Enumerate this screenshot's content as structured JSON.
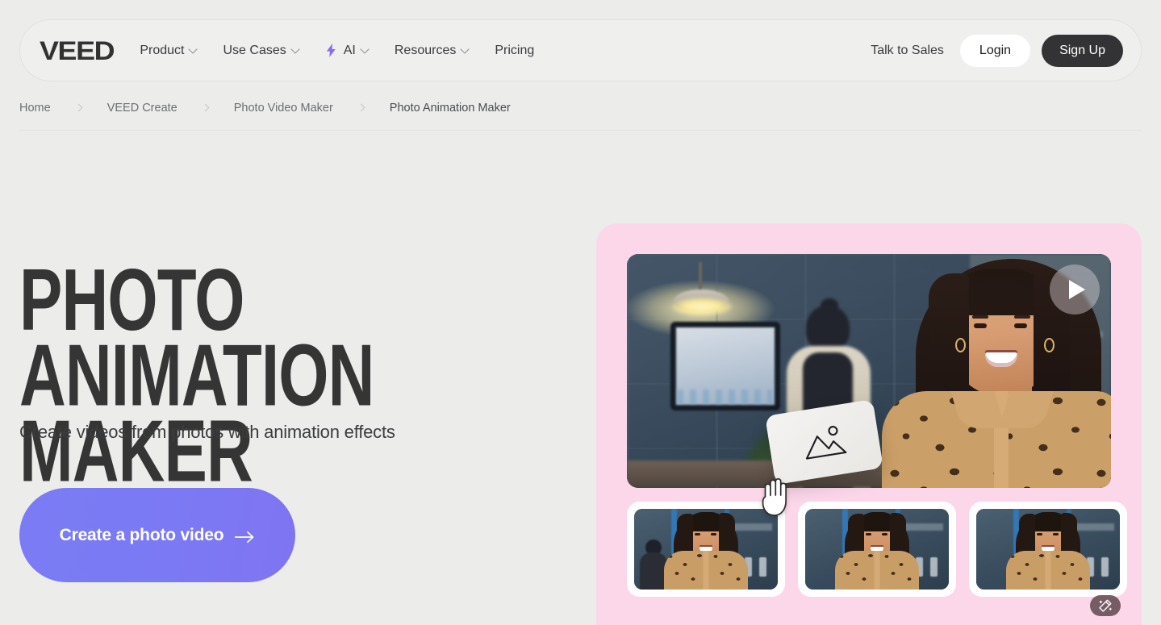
{
  "header": {
    "logo_text": "VEED",
    "nav_items": [
      {
        "label": "Product",
        "has_chevron": true,
        "icon": null
      },
      {
        "label": "Use Cases",
        "has_chevron": true,
        "icon": null
      },
      {
        "label": "AI",
        "has_chevron": true,
        "icon": "lightning-bolt-icon"
      },
      {
        "label": "Resources",
        "has_chevron": true,
        "icon": null
      },
      {
        "label": "Pricing",
        "has_chevron": false,
        "icon": null
      }
    ],
    "talk_to_sales": "Talk to Sales",
    "login_label": "Login",
    "signup_label": "Sign Up",
    "accent_color": "#7b7cf5",
    "signup_bg": "#333335",
    "login_bg": "#ffffff"
  },
  "breadcrumb": {
    "items": [
      "Home",
      "VEED Create",
      "Photo Video Maker",
      "Photo Animation Maker"
    ]
  },
  "hero": {
    "headline": "PHOTO ANIMATION\nMAKER",
    "subheadline": "Create videos from photos with animation effects",
    "cta_label": "Create a photo video",
    "cta_arrow": "→",
    "cta_gradient_from": "#7b7cf5",
    "cta_gradient_to": "#7f74f2"
  },
  "media": {
    "panel_bg": "#fcd7ea",
    "play_button_label": "Play",
    "drag_card_icon": "image-placeholder-icon",
    "cursor_icon": "grab-hand-cursor-icon",
    "thumbnails": [
      {
        "name": "thumbnail-1"
      },
      {
        "name": "thumbnail-2"
      },
      {
        "name": "thumbnail-3"
      }
    ],
    "ai_badge_icon": "magic-wand-icon"
  }
}
